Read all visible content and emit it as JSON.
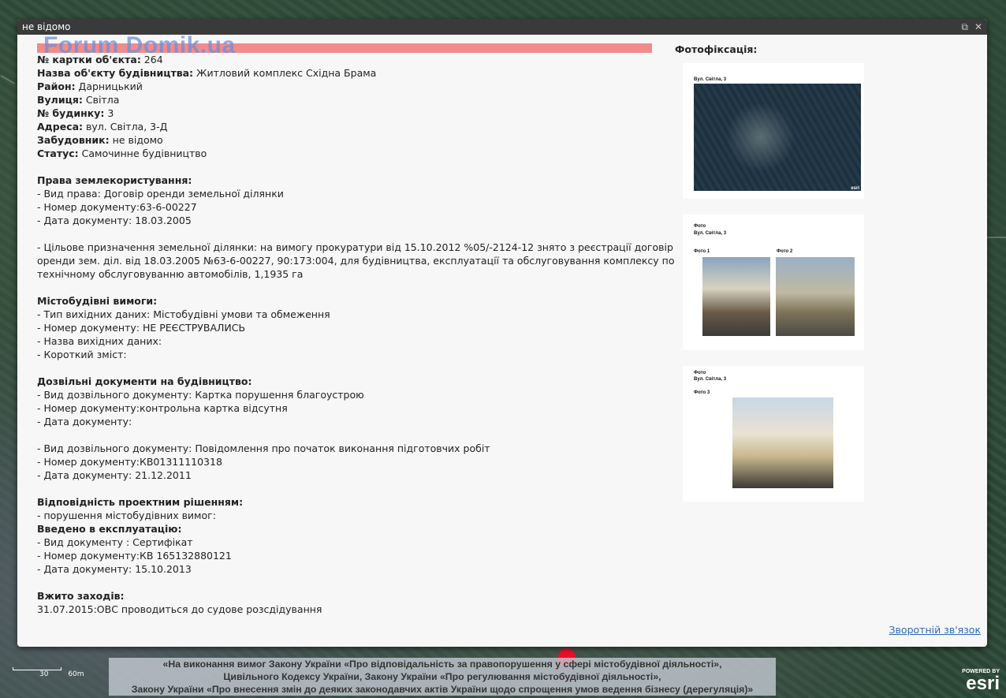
{
  "popup": {
    "title": "не відомо",
    "watermark": "Forum Domik.ua",
    "lines": [
      {
        "label": "№ картки об'єкта:",
        "value": " 264"
      },
      {
        "label": "Назва об'єкту будівництва:",
        "value": " Житловий комплекс Східна Брама"
      },
      {
        "label": "Район:",
        "value": " Дарницький"
      },
      {
        "label": "Вулиця:",
        "value": " Світла"
      },
      {
        "label": "№ будинку:",
        "value": " 3"
      },
      {
        "label": "Адреса:",
        "value": " вул. Світла, 3-Д"
      },
      {
        "label": "Забудовник:",
        "value": " не відомо"
      },
      {
        "label": "Статус:",
        "value": " Самочинне будівництво"
      },
      {
        "gap": true
      },
      {
        "label": "Права землекористування:",
        "value": ""
      },
      {
        "label": "",
        "value": "- Вид права: Договір оренди земельної ділянки"
      },
      {
        "label": "",
        "value": "- Номер документу:63-6-00227"
      },
      {
        "label": "",
        "value": "- Дата документу:  18.03.2005"
      },
      {
        "gap": true
      },
      {
        "label": "",
        "value": "- Цільове призначення земельної ділянки: на вимогу прокуратури від 15.10.2012 %05/-2124-12 знято з реєстрації договір"
      },
      {
        "label": "",
        "value": "оренди зем. діл. від 18.03.2005 №63-6-00227, 90:173:004, для будівництва, експлуатації та обслуговування комплексу по"
      },
      {
        "label": "",
        "value": "технічному обслуговуванню автомобілів, 1,1935 га"
      },
      {
        "gap": true
      },
      {
        "label": "Містобудівні вимоги:",
        "value": ""
      },
      {
        "label": "",
        "value": "- Тип вихідних даних: Містобудівні умови та обмеження"
      },
      {
        "label": "",
        "value": "- Номер документу:        НЕ РЕЄСТРУВАЛИСЬ"
      },
      {
        "label": "",
        "value": "- Назва вихідних даних:"
      },
      {
        "label": "",
        "value": "- Короткий зміст:"
      },
      {
        "gap": true
      },
      {
        "label": "Дозвільні документи на будівництво:",
        "value": ""
      },
      {
        "label": "",
        "value": "- Вид дозвільного документу: Картка порушення благоустрою"
      },
      {
        "label": "",
        "value": "- Номер документу:контрольна картка відсутня"
      },
      {
        "label": "",
        "value": "- Дата документу:"
      },
      {
        "gap": true
      },
      {
        "label": "",
        "value": "- Вид дозвільного документу: Повідомлення про початок виконання підготовчих робіт"
      },
      {
        "label": "",
        "value": "- Номер документу:КВ01311110318"
      },
      {
        "label": "",
        "value": "- Дата документу:  21.12.2011"
      },
      {
        "gap": true
      },
      {
        "label": "Відповідність проектним рішенням:",
        "value": ""
      },
      {
        "label": "",
        "value": "- порушення містобудівних вимог:"
      },
      {
        "label": "Введено в експлуатацію:",
        "value": ""
      },
      {
        "label": "",
        "value": "- Вид документу : Сертифікат"
      },
      {
        "label": "",
        "value": "- Номер документу:КВ 165132880121"
      },
      {
        "label": "",
        "value": "- Дата документу:  15.10.2013"
      },
      {
        "gap": true
      },
      {
        "label": "Вжито заходів:",
        "value": ""
      },
      {
        "label": "",
        "value": "31.07.2015:ОВС проводиться до судове розсдідування"
      }
    ],
    "photo_title": "Фотофіксація:",
    "photos": {
      "card1_caption": "Вул. Світла, 3",
      "card1_attribution": "esri",
      "card2_caption1": "Фото",
      "card2_caption2": "Вул. Світла, 3",
      "card2_label1": "Фото 1",
      "card2_label2": "Фото 2",
      "card3_caption1": "Фото",
      "card3_caption2": "Вул. Світла, 3",
      "card3_label": "Фото 3"
    },
    "feedback": "Зворотній зв'язок"
  },
  "legal": {
    "line1": "«На виконання вимог Закону України «Про відповідальність за правопорушення у сфері містобудівної діяльності»,",
    "line2": "Цивільного Кодексу України, Закону України «Про регулювання містобудівної діяльності»,",
    "line3": "Закону України «Про внесення змін до деяких законодавчих актів України щодо спрощення умов ведення бізнесу (дерегуляція)»"
  },
  "scale": {
    "label1": "30",
    "label2": "60m"
  },
  "esri": {
    "powered": "POWERED BY",
    "logo": "esri"
  },
  "icons": {
    "restore": "restore-icon",
    "close": "close-icon"
  }
}
